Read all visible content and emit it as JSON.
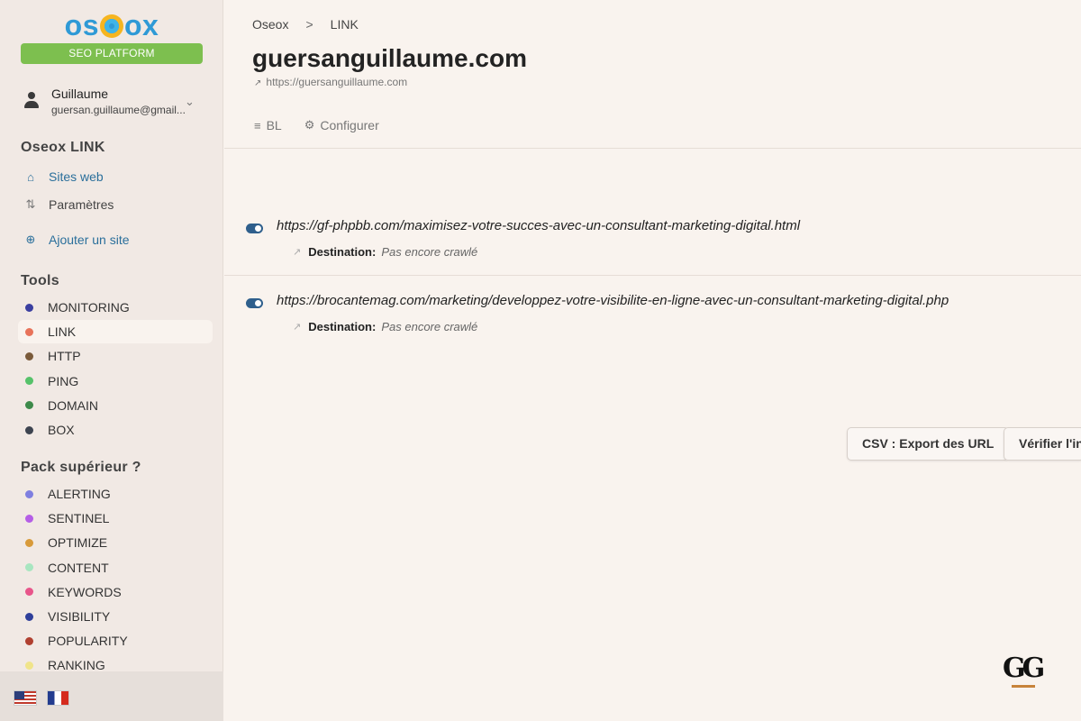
{
  "sidebar": {
    "logo": "oseox",
    "platform_badge": "SEO PLATFORM",
    "user": {
      "name": "Guillaume",
      "email": "guersan.guillaume@gmail..."
    },
    "section_link": "Oseox LINK",
    "nav": [
      {
        "label": "Sites web",
        "icon": "home-icon"
      },
      {
        "label": "Paramètres",
        "icon": "sliders-icon"
      },
      {
        "label": "Ajouter un site",
        "icon": "plus-circle-icon"
      }
    ],
    "tools_title": "Tools",
    "tools": [
      {
        "label": "MONITORING",
        "color": "#3b3fa0"
      },
      {
        "label": "LINK",
        "color": "#e8735a"
      },
      {
        "label": "HTTP",
        "color": "#7a5a3a"
      },
      {
        "label": "PING",
        "color": "#56c26a"
      },
      {
        "label": "DOMAIN",
        "color": "#3d8a4a"
      },
      {
        "label": "BOX",
        "color": "#3d4450"
      }
    ],
    "pack_title": "Pack supérieur ?",
    "pack": [
      {
        "label": "ALERTING",
        "color": "#7f7fe0"
      },
      {
        "label": "SENTINEL",
        "color": "#b55ee6"
      },
      {
        "label": "OPTIMIZE",
        "color": "#d89a3a"
      },
      {
        "label": "CONTENT",
        "color": "#a8e6c0"
      },
      {
        "label": "KEYWORDS",
        "color": "#e8558a"
      },
      {
        "label": "VISIBILITY",
        "color": "#2f3f9a"
      },
      {
        "label": "POPULARITY",
        "color": "#b04030"
      },
      {
        "label": "RANKING",
        "color": "#f0e48a"
      }
    ]
  },
  "breadcrumb": {
    "root": "Oseox",
    "separator": ">",
    "current": "LINK"
  },
  "page_title": "guersanguillaume.com",
  "site_url": "https://guersanguillaume.com",
  "tabs": [
    {
      "label": "BL",
      "icon": "list-icon"
    },
    {
      "label": "Configurer",
      "icon": "gear-icon"
    }
  ],
  "links": [
    {
      "url": "https://gf-phpbb.com/maximisez-votre-succes-avec-un-consultant-marketing-digital.html",
      "dest_label": "Destination:",
      "dest_value": "Pas encore crawlé"
    },
    {
      "url": "https://brocantemag.com/marketing/developpez-votre-visibilite-en-ligne-avec-un-consultant-marketing-digital.php",
      "dest_label": "Destination:",
      "dest_value": "Pas encore crawlé"
    }
  ],
  "buttons": {
    "export": "CSV : Export des URL",
    "verify": "Vérifier l'ind"
  },
  "watermark": "GG"
}
